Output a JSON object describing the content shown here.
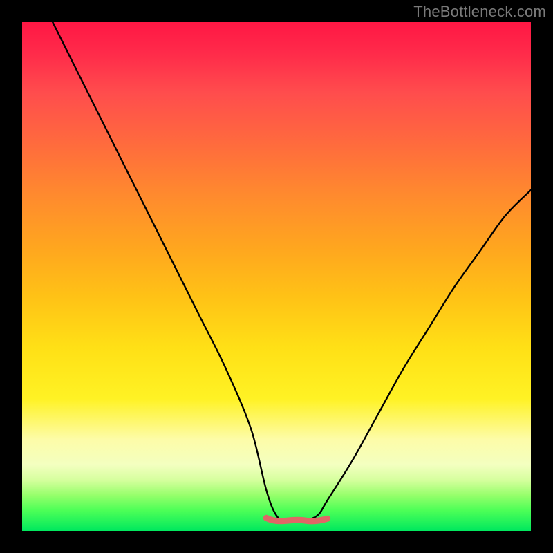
{
  "watermark": "TheBottleneck.com",
  "colors": {
    "page_bg": "#000000",
    "curve": "#000000",
    "valley_marker": "#e06666",
    "watermark_text": "#7a7a7a"
  },
  "chart_data": {
    "type": "line",
    "title": "",
    "xlabel": "",
    "ylabel": "",
    "xlim": [
      0,
      100
    ],
    "ylim": [
      0,
      100
    ],
    "note": "No numeric axis ticks or labels are visible; x/y values below are approximate percentages of the plot width/height read from the pixels. Higher y = higher on screen.",
    "series": [
      {
        "name": "v-curve",
        "x": [
          6,
          10,
          15,
          20,
          25,
          30,
          35,
          40,
          45,
          48,
          50,
          52,
          55,
          58,
          60,
          65,
          70,
          75,
          80,
          85,
          90,
          95,
          100
        ],
        "y": [
          100,
          92,
          82,
          72,
          62,
          52,
          42,
          32,
          20,
          8,
          3,
          2,
          2,
          3,
          6,
          14,
          23,
          32,
          40,
          48,
          55,
          62,
          67
        ]
      }
    ],
    "valley_marker": {
      "description": "Thick red dashed/segmented stroke highlighting the bottom of the V",
      "x_range": [
        48,
        60
      ],
      "y": 2
    },
    "background_gradient_stops": [
      {
        "pos": 0,
        "color": "#ff1744"
      },
      {
        "pos": 24,
        "color": "#ff6b3d"
      },
      {
        "pos": 54,
        "color": "#ffc216"
      },
      {
        "pos": 82,
        "color": "#fdfca8"
      },
      {
        "pos": 100,
        "color": "#00e85e"
      }
    ]
  }
}
